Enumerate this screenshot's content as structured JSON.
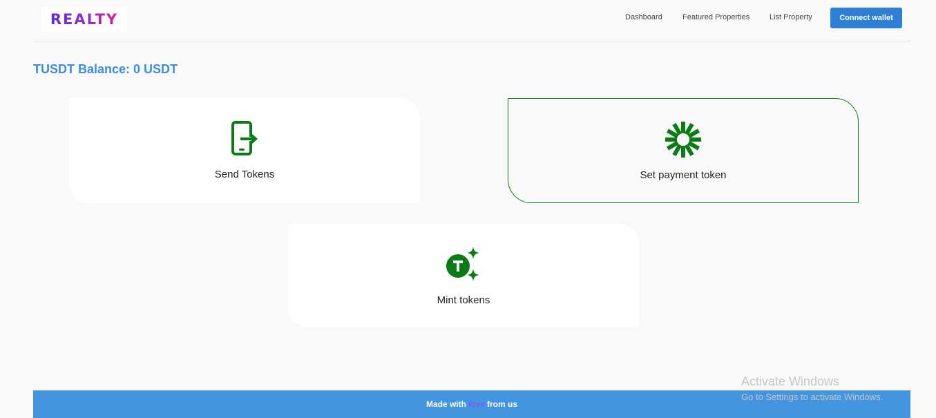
{
  "header": {
    "logo_text": "REALTY",
    "nav": [
      "Dashboard",
      "Featured Properties",
      "List Property"
    ],
    "connect_label": "Connect wallet"
  },
  "balance_text": "TUSDT Balance: 0 USDT",
  "cards": [
    {
      "label": "Send Tokens",
      "icon": "mobile-send-icon"
    },
    {
      "label": "Set payment token",
      "icon": "starburst-icon"
    },
    {
      "label": "Mint tokens",
      "icon": "token-sparkle-icon"
    }
  ],
  "footer": {
    "before": "Made with",
    "love": "love",
    "after": "from us"
  },
  "watermark": {
    "title": "Activate Windows",
    "subtitle": "Go to Settings to activate Windows."
  },
  "colors": {
    "accent": "#2e7fd6",
    "balance": "#3c8ee0",
    "icon_green": "#0a7c16",
    "footer": "#4495e0",
    "love": "#7b5bf0"
  }
}
